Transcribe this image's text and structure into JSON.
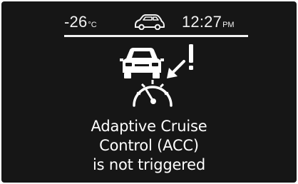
{
  "status_bar": {
    "temperature": "-26",
    "temperature_unit": "°C",
    "time": "12:27",
    "time_period": "PM",
    "vehicle_icon": "car-side-icon"
  },
  "warning": {
    "icon": "acc-car-speedometer-warning-icon",
    "message_lines": [
      "Adaptive Cruise",
      "Control (ACC)",
      "is not triggered"
    ]
  },
  "colors": {
    "background": "#161616",
    "foreground": "#ffffff"
  }
}
